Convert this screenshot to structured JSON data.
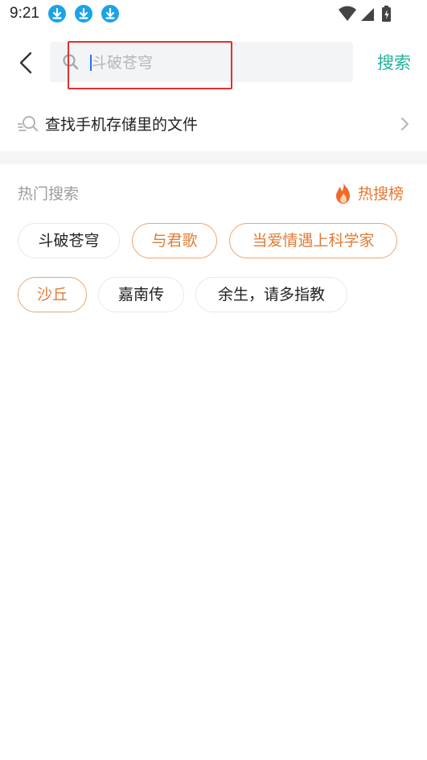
{
  "status_bar": {
    "time": "9:21",
    "notification_icons": [
      "download-icon",
      "download-icon",
      "download-icon"
    ],
    "accent_color": "#1aa3e8"
  },
  "header": {
    "back_icon": "back-arrow-icon",
    "search_placeholder": "斗破苍穹",
    "search_button": "搜索",
    "accent_color": "#22b39a"
  },
  "storage_search": {
    "label": "查找手机存储里的文件"
  },
  "hot_search": {
    "title": "热门搜索",
    "rank_label": "热搜榜",
    "rank_color": "#e4772f",
    "tags": [
      {
        "label": "斗破苍穹",
        "highlighted": false
      },
      {
        "label": "与君歌",
        "highlighted": true
      },
      {
        "label": "当爱情遇上科学家",
        "highlighted": true
      },
      {
        "label": "沙丘",
        "highlighted": true
      },
      {
        "label": "嘉南传",
        "highlighted": false
      },
      {
        "label": "余生，请多指教",
        "highlighted": false
      }
    ]
  }
}
